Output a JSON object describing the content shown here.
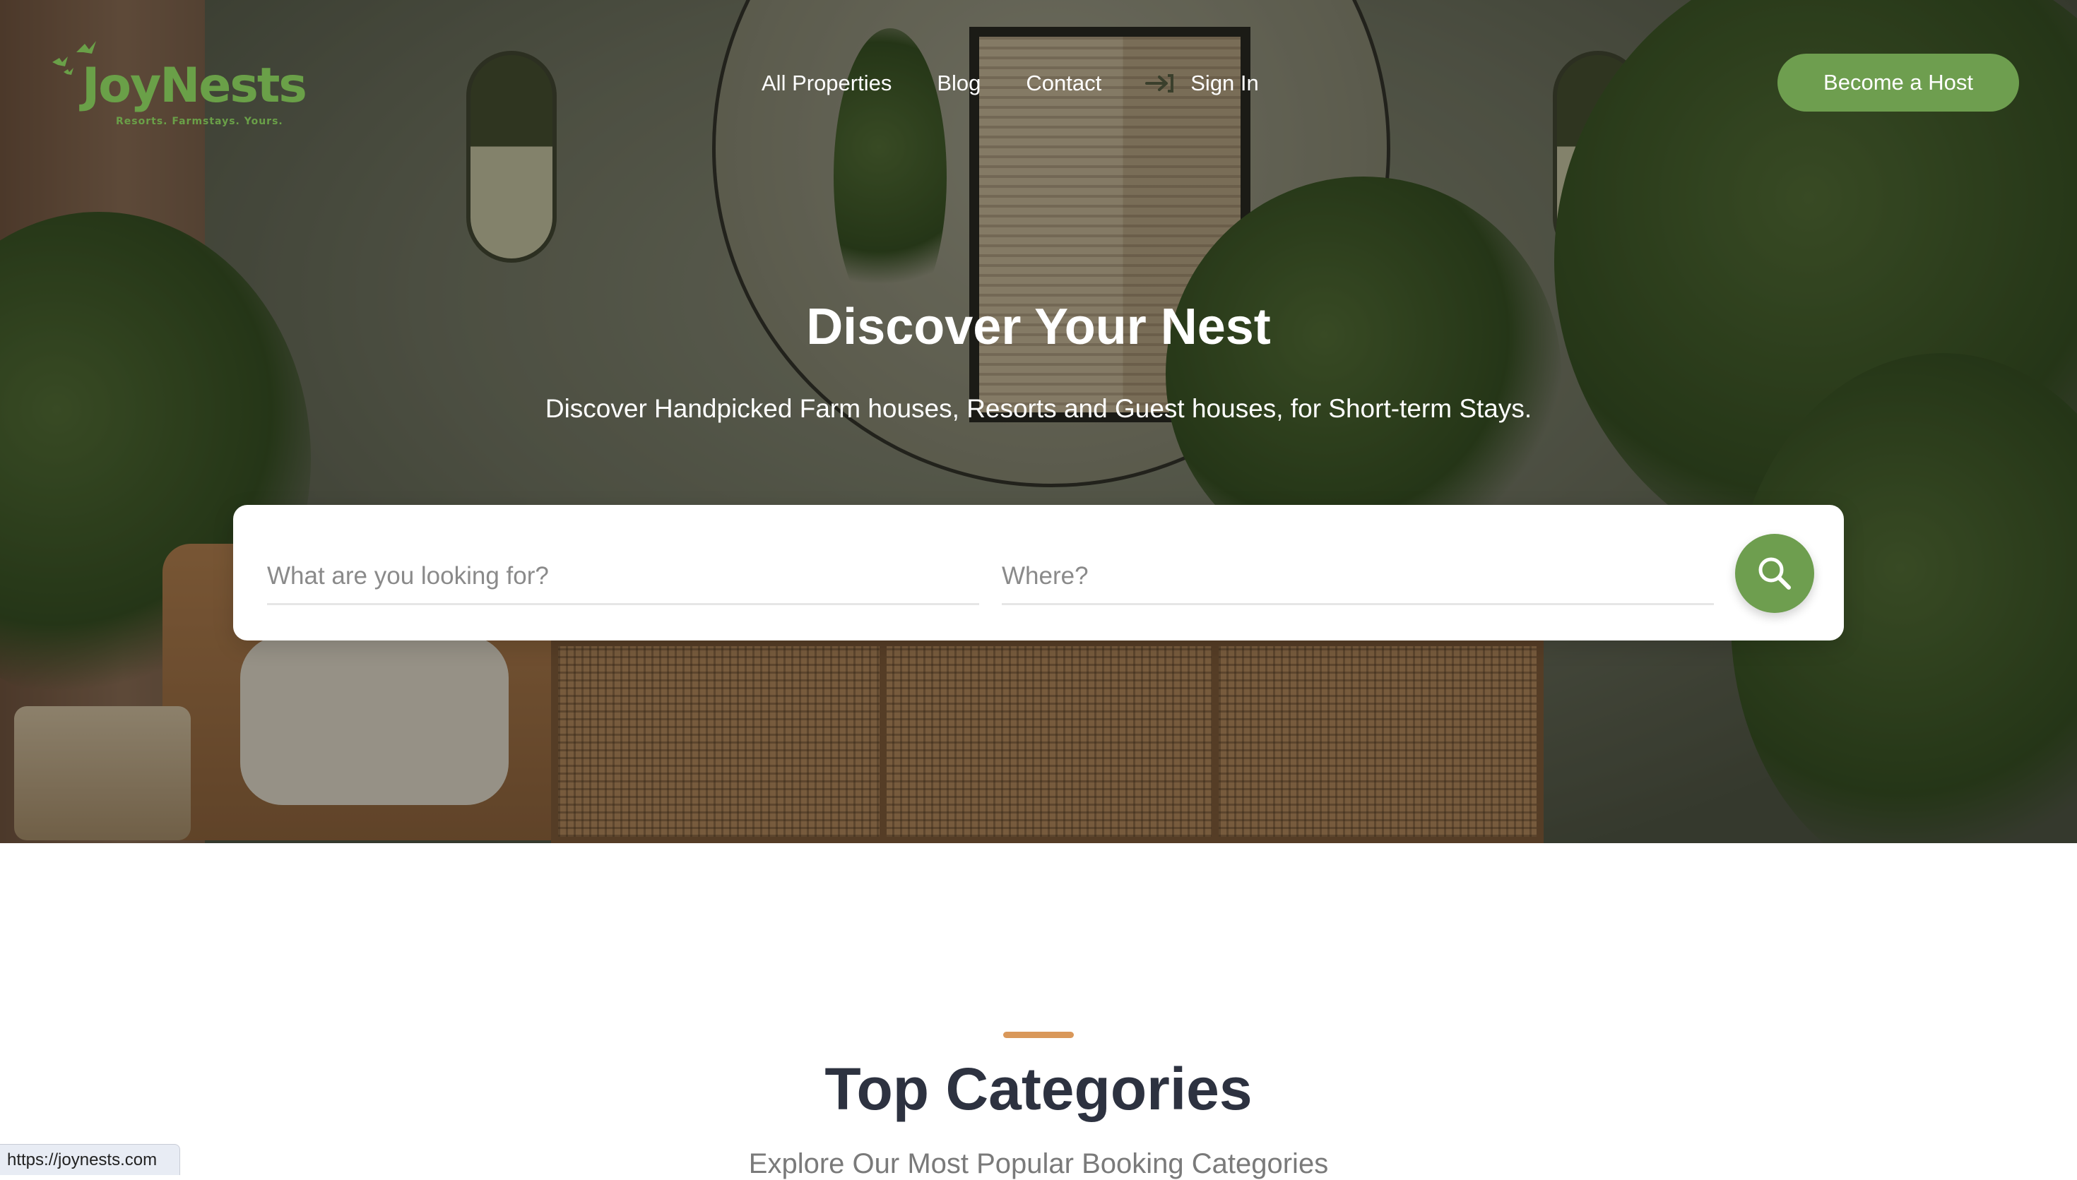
{
  "brand": {
    "name": "JoyNests",
    "tagline": "Resorts. Farmstays. Yours."
  },
  "nav": {
    "items": [
      "All Properties",
      "Blog",
      "Contact"
    ],
    "sign_in": "Sign In",
    "become_host": "Become a Host"
  },
  "hero": {
    "title": "Discover Your Nest",
    "subtitle": "Discover Handpicked Farm houses, Resorts and Guest houses, for Short-term Stays."
  },
  "search": {
    "what_placeholder": "What are you looking for?",
    "where_placeholder": "Where?",
    "what_value": "",
    "where_value": ""
  },
  "categories": {
    "title": "Top Categories",
    "subtitle": "Explore Our Most Popular Booking Categories"
  },
  "status_bar": {
    "url": "https://joynests.com"
  },
  "colors": {
    "brand_green": "#6e9e4f",
    "accent_orange": "#d9985a",
    "heading_dark": "#2d3240"
  },
  "icons": {
    "logo": "birds-icon",
    "sign_in": "sign-in-arrow-icon",
    "search_button": "search-icon"
  }
}
